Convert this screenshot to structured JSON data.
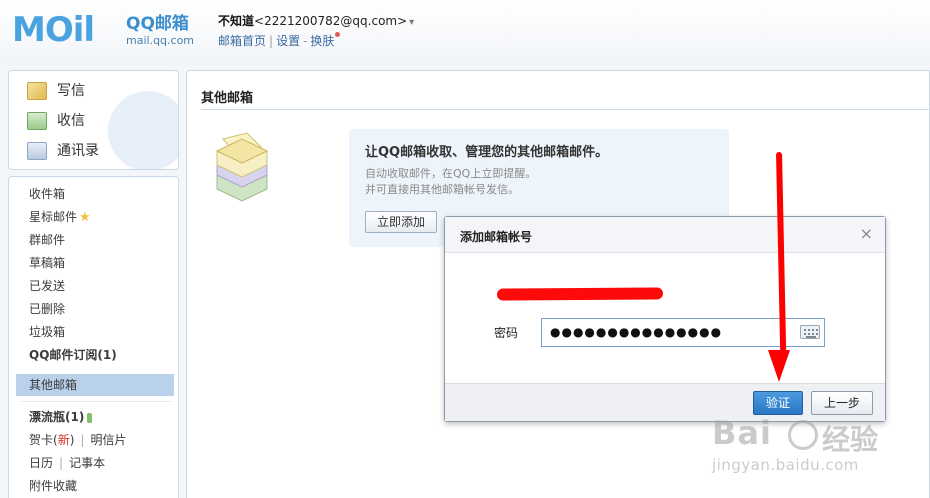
{
  "brand": {
    "logo_text": "MOil",
    "product_name": "QQ邮箱",
    "domain": "mail.qq.com"
  },
  "user": {
    "name": "不知道",
    "email": "<2221200782@qq.com>",
    "menu_caret": "▾"
  },
  "top_links": {
    "home": "邮箱首页",
    "settings": "设置",
    "separator_dash": "-",
    "skin": "换肤"
  },
  "quick_actions": {
    "write": "写信",
    "receive": "收信",
    "contacts": "通讯录"
  },
  "folders": {
    "inbox": "收件箱",
    "starred": "星标邮件",
    "group": "群邮件",
    "drafts": "草稿箱",
    "sent": "已发送",
    "deleted": "已删除",
    "spam": "垃圾箱",
    "subscriptions": "QQ邮件订阅(1)",
    "other_mailbox": "其他邮箱",
    "drift_bottle": "漂流瓶(1)",
    "greeting_card_prefix": "贺卡(",
    "greeting_card_new": "新",
    "greeting_card_suffix": ")",
    "postcard": "明信片",
    "calendar": "日历",
    "notebook": "记事本",
    "attachments": "附件收藏"
  },
  "main": {
    "title": "其他邮箱",
    "promo_title": "让QQ邮箱收取、管理您的其他邮箱邮件。",
    "promo_desc1": "自动收取邮件，在QQ上立即提醒。",
    "promo_desc2": "并可直接用其他邮箱帐号发信。",
    "add_now": "立即添加"
  },
  "dialog": {
    "title": "添加邮箱帐号",
    "close": "×",
    "password_label": "密码",
    "password_value": "●●●●●●●●●●●●●●●",
    "verify": "验证",
    "back": "上一步"
  },
  "watermark": {
    "brand": "Bai",
    "brand_cn": "经验",
    "url": "jingyan.baidu.com"
  },
  "colors": {
    "accent_blue": "#2a77c5",
    "annotation_red": "#ff0000",
    "active_folder_bg": "#b9d1ea"
  }
}
